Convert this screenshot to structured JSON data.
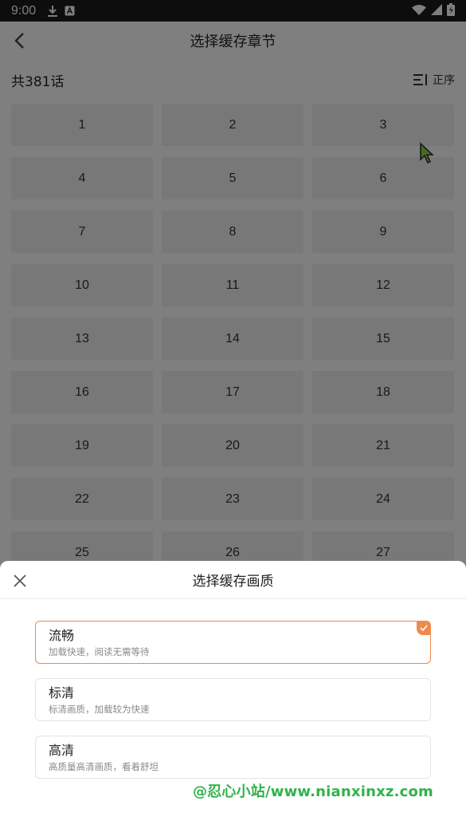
{
  "status_bar": {
    "time": "9:00"
  },
  "header": {
    "title": "选择缓存章节"
  },
  "summary": {
    "count_label": "共381话",
    "sort_label": "正序"
  },
  "chapters": [
    "1",
    "2",
    "3",
    "4",
    "5",
    "6",
    "7",
    "8",
    "9",
    "10",
    "11",
    "12",
    "13",
    "14",
    "15",
    "16",
    "17",
    "18",
    "19",
    "20",
    "21",
    "22",
    "23",
    "24",
    "25",
    "26",
    "27"
  ],
  "sheet": {
    "title": "选择缓存画质",
    "options": [
      {
        "name": "流畅",
        "desc": "加载快速，阅读无需等待",
        "selected": true
      },
      {
        "name": "标清",
        "desc": "标清画质，加载较为快速",
        "selected": false
      },
      {
        "name": "高清",
        "desc": "高质量高清画质，看着舒坦",
        "selected": false
      }
    ]
  },
  "watermark": "@忍心小站/www.nianxinxz.com",
  "colors": {
    "accent": "#f0894d",
    "cell_bg": "#f1f1f1",
    "watermark": "#2fb34a"
  }
}
